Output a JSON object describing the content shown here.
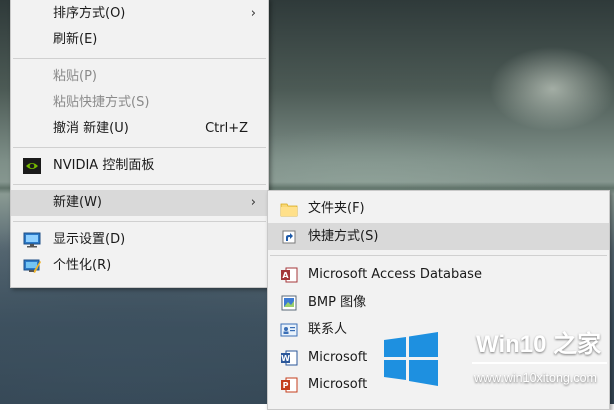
{
  "context_menu": {
    "items": [
      {
        "label": "排序方式(O)",
        "has_submenu": true,
        "disabled": false
      },
      {
        "label": "刷新(E)",
        "disabled": false
      },
      {
        "label": "粘贴(P)",
        "disabled": true
      },
      {
        "label": "粘贴快捷方式(S)",
        "disabled": true
      },
      {
        "label": "撤消 新建(U)",
        "shortcut": "Ctrl+Z",
        "disabled": false
      },
      {
        "label": "NVIDIA 控制面板",
        "icon": "nvidia-icon",
        "disabled": false
      },
      {
        "label": "新建(W)",
        "has_submenu": true,
        "highlighted": true
      },
      {
        "label": "显示设置(D)",
        "icon": "display-settings-icon"
      },
      {
        "label": "个性化(R)",
        "icon": "personalize-icon"
      }
    ]
  },
  "new_submenu": {
    "items": [
      {
        "label": "文件夹(F)",
        "icon": "folder-icon"
      },
      {
        "label": "快捷方式(S)",
        "icon": "shortcut-icon",
        "highlighted": true
      },
      {
        "label": "Microsoft Access Database",
        "icon": "access-icon"
      },
      {
        "label": "BMP 图像",
        "icon": "bmp-image-icon"
      },
      {
        "label": "联系人",
        "icon": "contact-icon"
      },
      {
        "label": "Microsoft",
        "icon": "word-icon"
      },
      {
        "label": "Microsoft",
        "icon": "powerpoint-icon"
      }
    ]
  },
  "watermark": {
    "title": "Win10 之家",
    "url": "www.win10xitong.com"
  },
  "colors": {
    "menu_bg": "#f2f2f2",
    "highlight": "#d9d9d9",
    "disabled_text": "#8a8a8a",
    "windows_blue": "#1e90e0"
  }
}
